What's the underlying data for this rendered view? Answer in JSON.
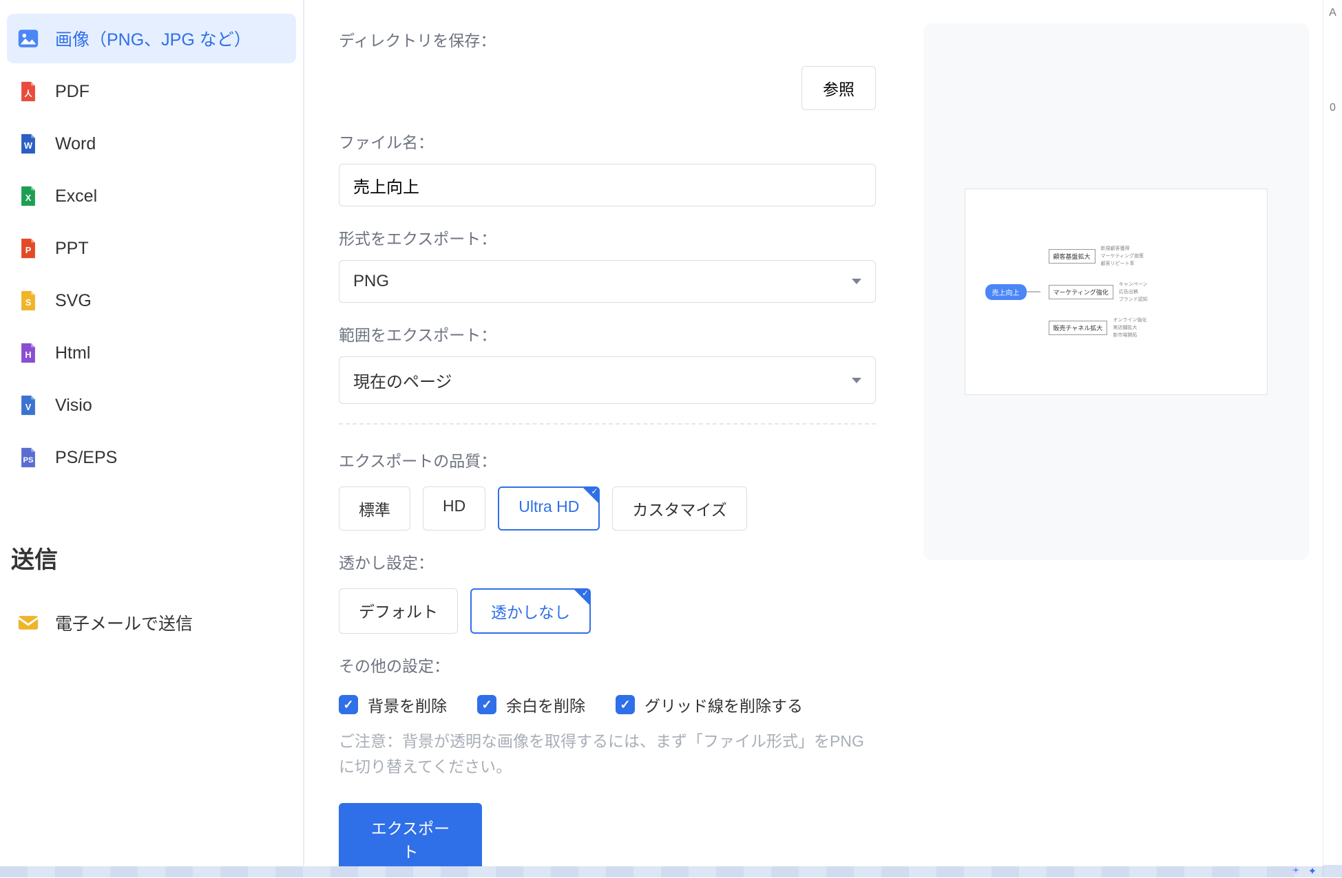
{
  "sidebar": {
    "items": [
      {
        "label": "画像（PNG、JPG など）"
      },
      {
        "label": "PDF"
      },
      {
        "label": "Word"
      },
      {
        "label": "Excel"
      },
      {
        "label": "PPT"
      },
      {
        "label": "SVG"
      },
      {
        "label": "Html"
      },
      {
        "label": "Visio"
      },
      {
        "label": "PS/EPS"
      }
    ],
    "send_header": "送信",
    "email_label": "電子メールで送信"
  },
  "form": {
    "dir_label": "ディレクトリを保存：",
    "browse_btn": "参照",
    "filename_label": "ファイル名：",
    "filename_value": "売上向上",
    "format_label": "形式をエクスポート：",
    "format_value": "PNG",
    "range_label": "範囲をエクスポート：",
    "range_value": "現在のページ",
    "quality_label": "エクスポートの品質：",
    "quality_options": {
      "standard": "標準",
      "hd": "HD",
      "ultra": "Ultra HD",
      "custom": "カスタマイズ"
    },
    "wm_label": "透かし設定：",
    "wm_options": {
      "default": "デフォルト",
      "none": "透かしなし"
    },
    "other_label": "その他の設定：",
    "checks": {
      "bg": "背景を削除",
      "margin": "余白を削除",
      "grid": "グリッド線を削除する"
    },
    "note": "ご注意：背景が透明な画像を取得するには、まず「ファイル形式」をPNGに切り替えてください。",
    "export_btn": "エクスポート"
  },
  "preview": {
    "root": "売上向上",
    "branches": [
      {
        "label": "顧客基盤拡大",
        "leaves": [
          "新規顧客獲得",
          "マーケティング施策",
          "顧客リピート率"
        ]
      },
      {
        "label": "マーケティング強化",
        "leaves": [
          "キャンペーン",
          "広告出稿",
          "ブランド認知"
        ]
      },
      {
        "label": "販売チャネル拡大",
        "leaves": [
          "オンライン強化",
          "実店舗拡大",
          "新市場開拓"
        ]
      }
    ]
  },
  "right_strip": {
    "top": "A",
    "zero": "0"
  }
}
